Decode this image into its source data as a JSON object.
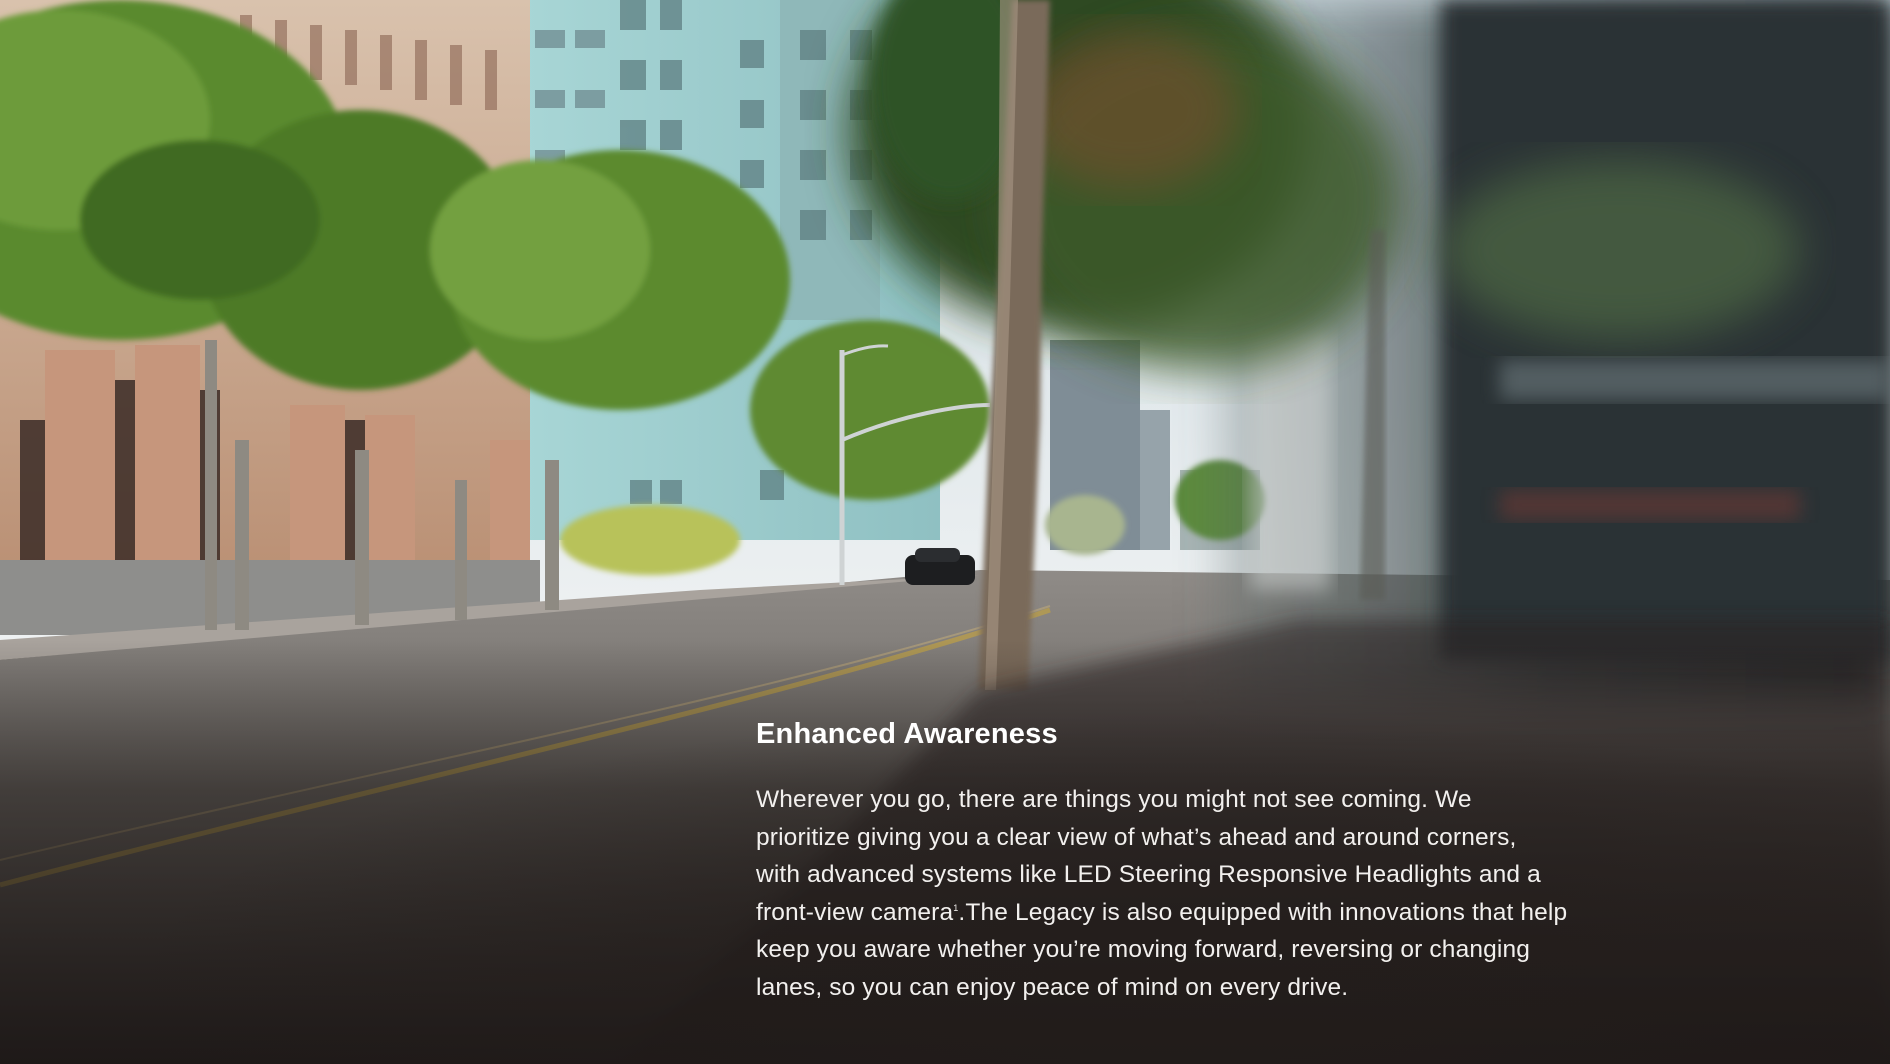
{
  "article": {
    "heading": "Enhanced Awareness",
    "body_lines": [
      "Wherever you go, there are things you might not see coming. We",
      "prioritize giving you a clear view of what’s ahead and around corners,",
      "with advanced systems like LED Steering Responsive Headlights and a",
      "front-view camera",
      ".The Legacy is also equipped with innovations that help",
      "keep you aware whether you’re moving forward, reversing or changing",
      "lanes, so you can enjoy peace of mind on every drive."
    ],
    "footnote_marker": "1"
  },
  "colors": {
    "sky": "#dbe5ea",
    "tower": "#9fcfcf",
    "stone_building": "#caa88f",
    "tree_green": "#4f7a2a",
    "road": "#6f6b67",
    "shadow": "#241f1d",
    "lane_line": "#b59b4f",
    "text": "#ffffff"
  }
}
